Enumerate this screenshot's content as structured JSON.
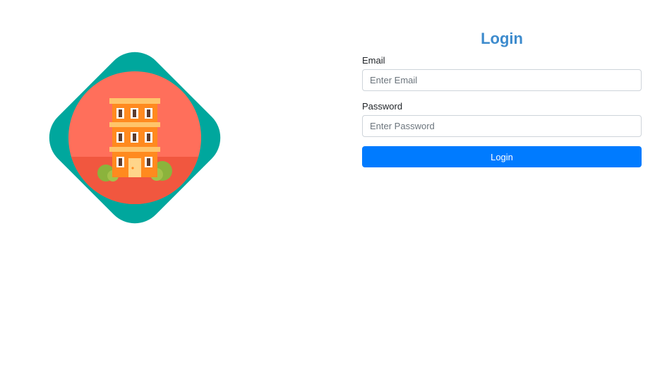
{
  "colors": {
    "title": "#3d8bcd",
    "primary_button": "#007bff",
    "diamond": "#00a79d",
    "circle": "#ff6f5b",
    "building": "#ff8a1f"
  },
  "illustration": {
    "icon": "hotel-building-icon"
  },
  "login": {
    "title": "Login",
    "email_label": "Email",
    "email_placeholder": "Enter Email",
    "email_value": "",
    "password_label": "Password",
    "password_placeholder": "Enter Password",
    "password_value": "",
    "button_label": "Login"
  }
}
